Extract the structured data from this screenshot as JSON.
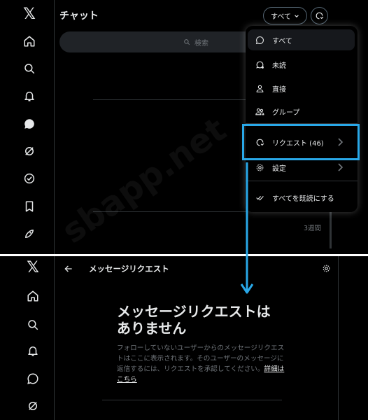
{
  "top": {
    "chat_title": "チャット",
    "filter_button_label": "すべて",
    "search_placeholder": "検索",
    "time_ago": "3週間",
    "dropdown": {
      "items": [
        {
          "label": "すべて",
          "icon": "chat-bubble-icon"
        },
        {
          "label": "未読",
          "icon": "unread-bubble-icon"
        },
        {
          "label": "直接",
          "icon": "person-icon"
        },
        {
          "label": "グループ",
          "icon": "group-icon"
        },
        {
          "label": "リクエスト (46)",
          "icon": "request-icon"
        },
        {
          "label": "設定",
          "icon": "gear-icon"
        },
        {
          "label": "すべてを既読にする",
          "icon": "mark-read-icon"
        }
      ]
    }
  },
  "bottom": {
    "page_title": "メッセージリクエスト",
    "empty_title": "メッセージリクエストはありません",
    "empty_body": "フォローしていないユーザーからのメッセージリクエストはここに表示されます。そのユーザーのメッセージに返信するには、リクエストを承認してください。",
    "learn_more_link": "詳細はこちら"
  },
  "watermark": "sbapp.net",
  "colors": {
    "background": "#000000",
    "highlight": "#29a8e8",
    "text": "#e7e9ea",
    "muted": "#71767b"
  }
}
